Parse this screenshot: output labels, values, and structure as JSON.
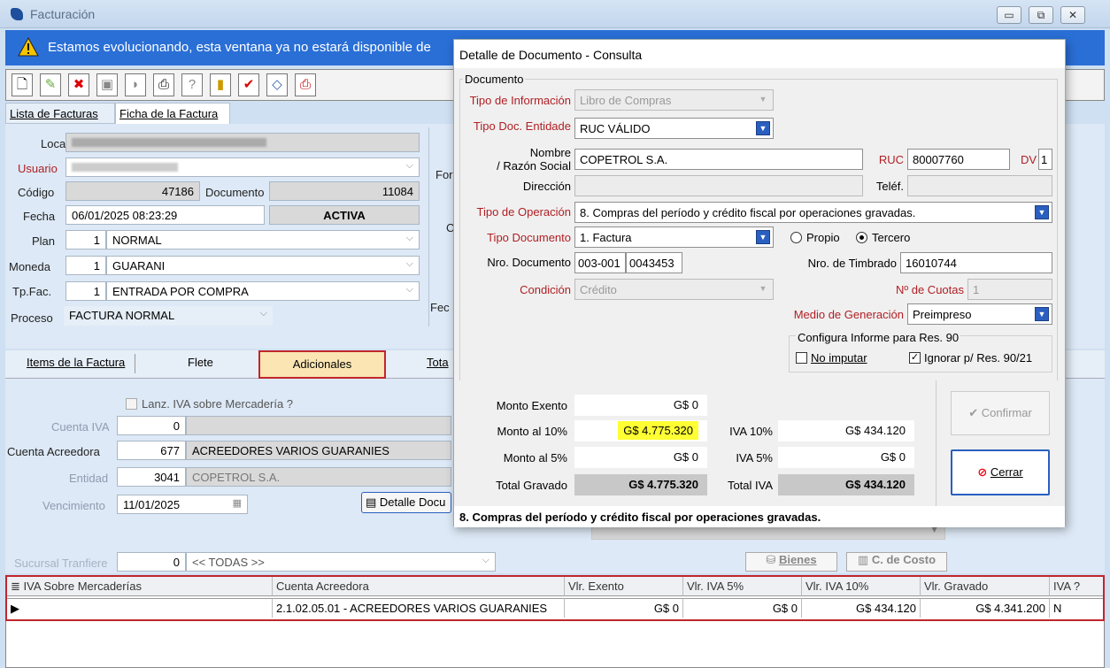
{
  "window": {
    "title": "Facturación",
    "min": "▭",
    "max": "⧉",
    "close": "✕"
  },
  "banner": {
    "text": "Estamos evolucionando, esta ventana ya no estará disponible de"
  },
  "tabs_top": [
    "Lista de Facturas",
    "Ficha de la Factura"
  ],
  "form": {
    "local_label": "Local",
    "usuario_label": "Usuario",
    "codigo_label": "Código",
    "codigo_value": "47186",
    "documento_label": "Documento",
    "documento_value": "11084",
    "fecha_label": "Fecha",
    "fecha_value": "06/01/2025 08:23:29",
    "estado": "ACTIVA",
    "plan_label": "Plan",
    "plan_num": "1",
    "plan_value": "NORMAL",
    "moneda_label": "Moneda",
    "moneda_num": "1",
    "moneda_value": "GUARANI",
    "tpfac_label": "Tp.Fac.",
    "tpfac_num": "1",
    "tpfac_value": "ENTRADA POR COMPRA",
    "proceso_label": "Proceso",
    "proceso_value": "FACTURA NORMAL",
    "side_for": "For",
    "side_c": "C",
    "side_fec": "Fec"
  },
  "tabs_sub": [
    "Items de la Factura",
    "Flete",
    "Adicionales",
    "Tota"
  ],
  "adic": {
    "lanz_label": "Lanz. IVA sobre Mercadería ?",
    "cuenta_iva_label": "Cuenta IVA",
    "cuenta_iva_num": "0",
    "cuenta_acreedora_label": "Cuenta Acreedora",
    "cuenta_acreedora_num": "677",
    "cuenta_acreedora_value": "ACREEDORES VARIOS GUARANIES",
    "entidad_label": "Entidad",
    "entidad_num": "3041",
    "entidad_value": "COPETROL S.A.",
    "vencimiento_label": "Vencimiento",
    "vencimiento_value": "11/01/2025",
    "detalle_btn": "Detalle Docu",
    "sucursal_label": "Sucursal Tranfiere",
    "sucursal_num": "0",
    "sucursal_value": "<< TODAS >>",
    "bienes_btn": "Bienes",
    "ccosto_btn": "C. de Costo"
  },
  "grid": {
    "headers": [
      "IVA Sobre Mercaderías",
      "Cuenta Acreedora",
      "Vlr. Exento",
      "Vlr. IVA 5%",
      "Vlr. IVA 10%",
      "Vlr. Gravado",
      "IVA ?"
    ],
    "row": [
      "",
      "2.1.02.05.01 - ACREEDORES VARIOS GUARANIES",
      "G$ 0",
      "G$ 0",
      "G$ 434.120",
      "G$ 4.341.200",
      "N"
    ]
  },
  "dialog": {
    "title": "Detalle de Documento - Consulta",
    "group": "Documento",
    "tipo_info_label": "Tipo de Información",
    "tipo_info_value": "Libro de Compras",
    "tipo_doc_ent_label": "Tipo Doc. Entidade",
    "tipo_doc_ent_value": "RUC VÁLIDO",
    "nombre_label1": "Nombre",
    "nombre_label2": "/ Razón Social",
    "nombre_value": "COPETROL S.A.",
    "ruc_label": "RUC",
    "ruc_value": "80007760",
    "dv_label": "DV",
    "dv_value": "1",
    "direccion_label": "Dirección",
    "telef_label": "Teléf.",
    "tipo_op_label": "Tipo de Operación",
    "tipo_op_value": "8. Compras del período y crédito fiscal por operaciones gravadas.",
    "tipo_documento_label": "Tipo Documento",
    "tipo_documento_value": "1. Factura",
    "propio_label": "Propio",
    "tercero_label": "Tercero",
    "nro_doc_label": "Nro. Documento",
    "nro_doc_a": "003-001",
    "nro_doc_b": "0043453",
    "nro_timbrado_label": "Nro. de Timbrado",
    "nro_timbrado_value": "16010744",
    "condicion_label": "Condición",
    "condicion_value": "Crédito",
    "cuotas_label": "Nº de Cuotas",
    "cuotas_value": "1",
    "medio_label": "Medio de Generación",
    "medio_value": "Preimpreso",
    "config_label": "Configura Informe para Res. 90",
    "no_imputar_label": "No imputar",
    "ignorar_label": "Ignorar p/ Res. 90/21",
    "monto_exento_label": "Monto Exento",
    "monto_exento_value": "G$ 0",
    "monto10_label": "Monto al 10%",
    "monto10_value": "G$ 4.775.320",
    "iva10_label": "IVA 10%",
    "iva10_value": "G$ 434.120",
    "monto5_label": "Monto al 5%",
    "monto5_value": "G$ 0",
    "iva5_label": "IVA 5%",
    "iva5_value": "G$ 0",
    "total_grav_label": "Total Gravado",
    "total_grav_value": "G$ 4.775.320",
    "total_iva_label": "Total IVA",
    "total_iva_value": "G$ 434.120",
    "confirmar_btn": "Confirmar",
    "cerrar_btn": "Cerrar",
    "footer": "8. Compras del período y crédito fiscal por operaciones gravadas."
  }
}
